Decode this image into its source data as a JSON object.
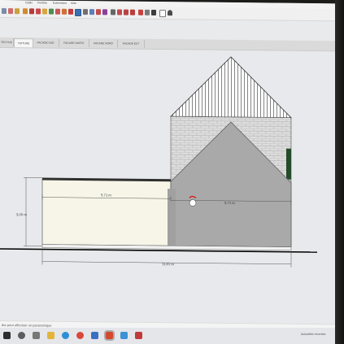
{
  "app": {
    "menu": [
      "Outils",
      "Fenêtre",
      "Extensions",
      "Aide"
    ],
    "toolbar_icons": [
      "select-icon",
      "eraser-icon",
      "paint-bucket-icon",
      "pencil-icon",
      "rectangle-icon",
      "circle-icon",
      "arc-icon",
      "push-pull-icon",
      "move-icon",
      "rotate-icon",
      "scale-icon",
      "offset-icon",
      "tape-measure-icon",
      "dimension-icon",
      "text-icon",
      "axes-icon",
      "orbit-icon",
      "pan-icon",
      "zoom-icon",
      "zoom-extents-icon",
      "previous-view-icon",
      "section-icon",
      "component-icon",
      "house-icon",
      "document-icon",
      "user-icon"
    ]
  },
  "scene_tabs": [
    {
      "label": "TECTIVE 2",
      "active": false
    },
    {
      "label": "TOITURE",
      "active": true
    },
    {
      "label": "FACADE SUD",
      "active": false
    },
    {
      "label": "FACADE OUEST",
      "active": false
    },
    {
      "label": "FACADE NORD",
      "active": false
    },
    {
      "label": "FACADE EST",
      "active": false
    }
  ],
  "drawing": {
    "dim_width_left": "5,71 m",
    "dim_width_right": "5,71 m",
    "dim_height": "3,00 m",
    "dim_total": "11,61 m",
    "colors": {
      "background": "#e8e9ec",
      "wall_cream": "#f6f5e7",
      "volume_gray": "#a9a9a9",
      "brick_gray": "#d9d9d9",
      "roof_stripes": "#ffffff",
      "ground_line": "#000000"
    }
  },
  "status": {
    "text": "dur pour effectuer un panoramique",
    "tray": "Actualités récentes"
  },
  "taskbar": {
    "icons": [
      "start-icon",
      "search-icon",
      "task-view-icon",
      "file-explorer-icon",
      "edge-icon",
      "chrome-icon",
      "mail-icon",
      "sketchup-icon",
      "photos-icon",
      "app-icon"
    ]
  }
}
